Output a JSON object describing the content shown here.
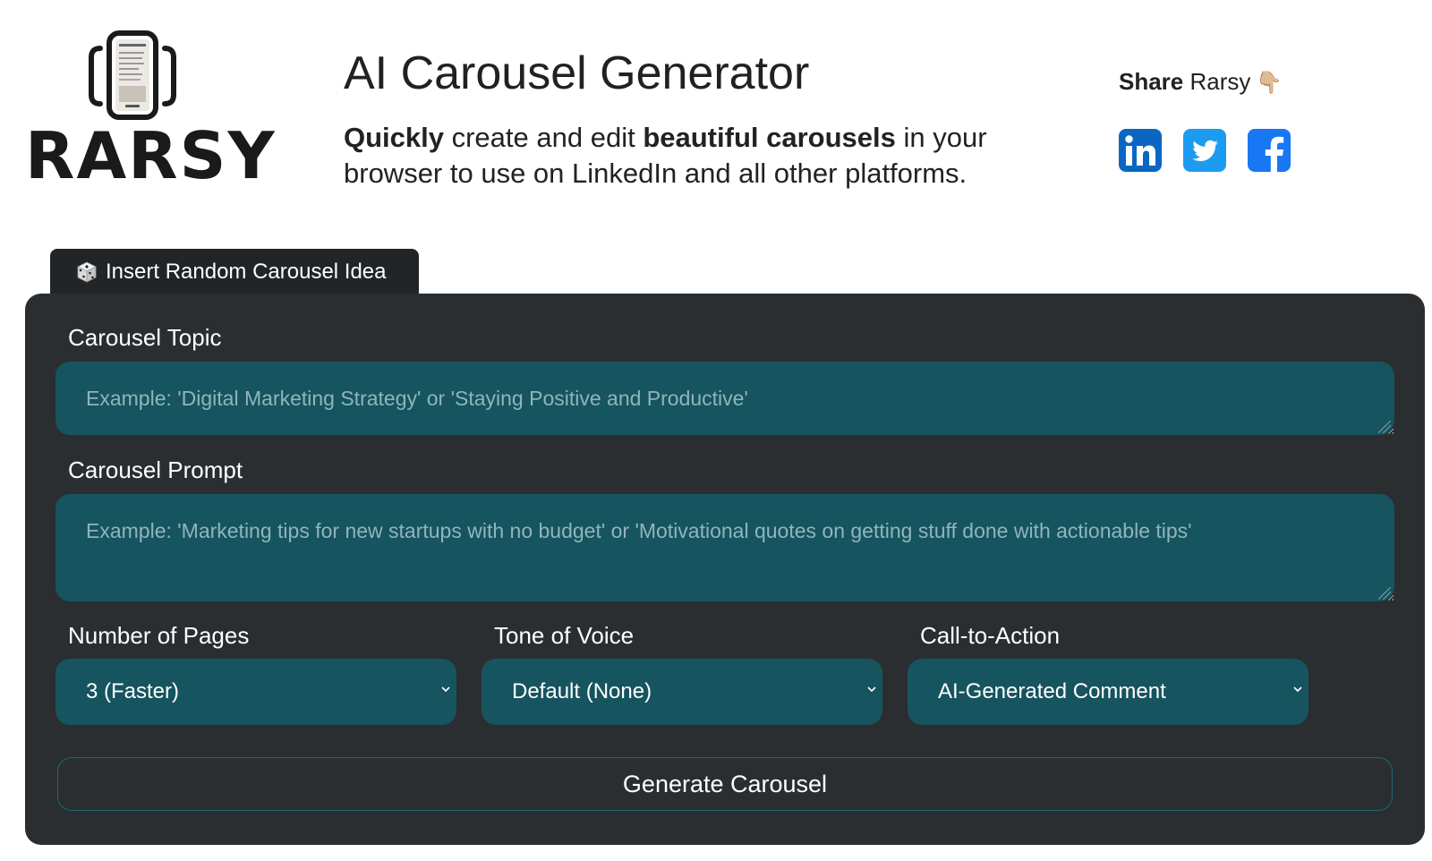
{
  "brand": {
    "name": "RARSY",
    "icon": "phone-carousel-logo"
  },
  "header": {
    "title": "AI Carousel Generator",
    "subtitle": {
      "bold1": "Quickly",
      "text1": " create and edit ",
      "bold2": "beautiful carousels",
      "text2": " in your browser to use on LinkedIn and all other platforms."
    }
  },
  "share": {
    "bold": "Share",
    "text": " Rarsy",
    "emoji": "👇🏼",
    "links": [
      {
        "name": "linkedin",
        "icon": "linkedin-icon",
        "color": "#0a66c2"
      },
      {
        "name": "twitter",
        "icon": "twitter-icon",
        "color": "#1d9bf0"
      },
      {
        "name": "facebook",
        "icon": "facebook-icon",
        "color": "#1877f2"
      }
    ]
  },
  "random_idea": {
    "icon": "dice-icon",
    "label": "Insert Random Carousel Idea"
  },
  "form": {
    "topic": {
      "label": "Carousel Topic",
      "placeholder": "Example: 'Digital Marketing Strategy' or 'Staying Positive and Productive'",
      "value": ""
    },
    "prompt": {
      "label": "Carousel Prompt",
      "placeholder": "Example: 'Marketing tips for new startups with no budget' or 'Motivational quotes on getting stuff done with actionable tips'",
      "value": ""
    },
    "pages": {
      "label": "Number of Pages",
      "selected": "3 (Faster)"
    },
    "tone": {
      "label": "Tone of Voice",
      "selected": "Default (None)"
    },
    "cta": {
      "label": "Call-to-Action",
      "selected": "AI-Generated Comment"
    },
    "generate_label": "Generate Carousel"
  },
  "colors": {
    "card_bg": "#2b2e30",
    "field_bg": "#16545f",
    "tab_bg": "#222527"
  }
}
